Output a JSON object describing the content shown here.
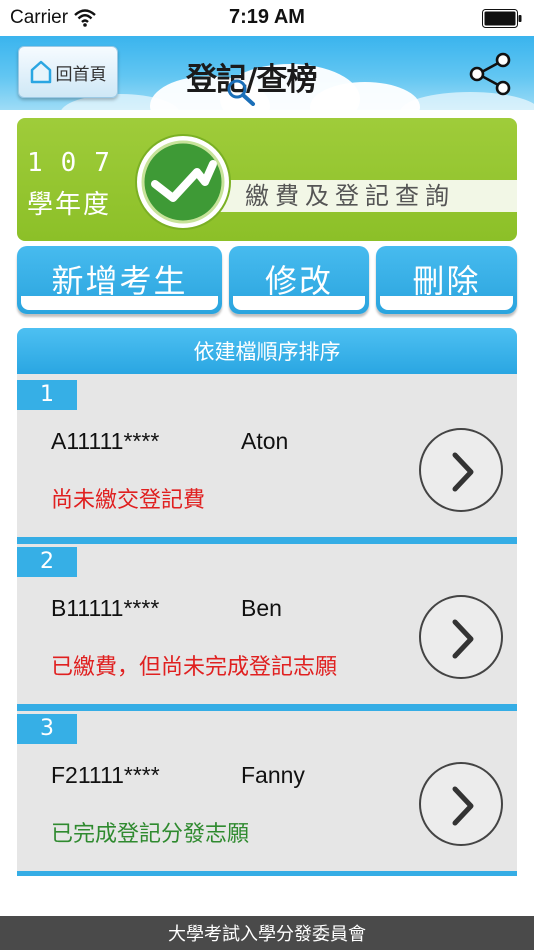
{
  "status_bar": {
    "carrier": "Carrier",
    "time": "7:19 AM"
  },
  "nav": {
    "home_label": "回首頁",
    "logo_text": "登記/查榜"
  },
  "banner": {
    "year": "107",
    "term": "學年度",
    "caption": "繳費及登記查詢"
  },
  "actions": {
    "add_label": "新增考生",
    "edit_label": "修改",
    "delete_label": "刪除"
  },
  "list": {
    "header": "依建檔順序排序",
    "entries": [
      {
        "num": "1",
        "id": "A11111****",
        "name": "Aton",
        "status": "尚未繳交登記費",
        "status_color": "#e02020"
      },
      {
        "num": "2",
        "id": "B11111****",
        "name": "Ben",
        "status": "已繳費，但尚未完成登記志願",
        "status_color": "#e02020"
      },
      {
        "num": "3",
        "id": "F21111****",
        "name": "Fanny",
        "status": "已完成登記分發志願",
        "status_color": "#2f8a2f"
      }
    ]
  },
  "footer": {
    "text": "大學考試入學分發委員會"
  },
  "colors": {
    "accent_blue": "#2aa6e2",
    "banner_green": "#8cc028",
    "footer_gray": "#4a4a4a"
  },
  "icons": {
    "home": "home-icon",
    "share": "share-icon",
    "chevron": "chevron-right-icon",
    "wifi": "wifi-icon",
    "battery": "battery-icon",
    "emblem": "checkmark-emblem-icon",
    "search": "magnifier-icon"
  }
}
